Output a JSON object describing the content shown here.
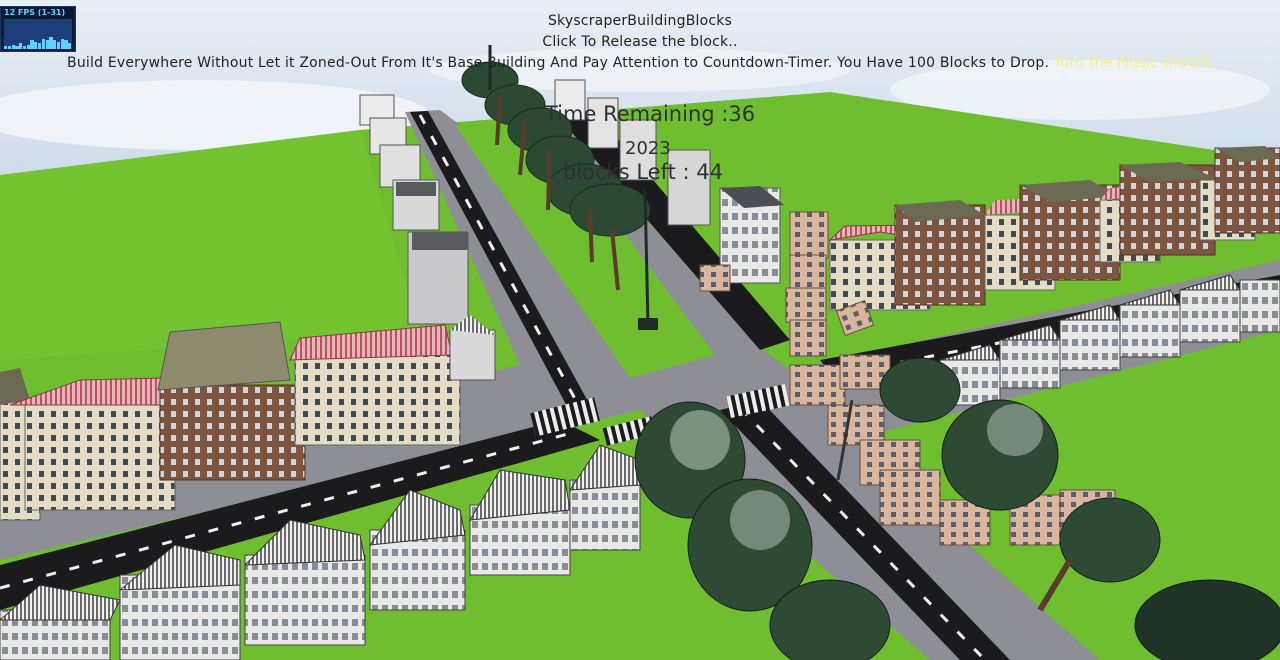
{
  "hud": {
    "fps_label": "12 FPS (1-31)",
    "title": "SkyscraperBuildingBlocks",
    "click_text": "Click To Release the block..",
    "instructions": "Build Everywhere Without Let it Zoned-Out From It's Base-Building And Pay Attention to Countdown-Timer. You Have 100 Blocks to Drop.",
    "music_link": "Turn the Music On/Off.",
    "time_remaining": "Time Remaining :36",
    "counter": "2023",
    "blocks_left": "blocks Left : 44"
  },
  "fps_graph": [
    0.1,
    0.1,
    0.15,
    0.1,
    0.2,
    0.1,
    0.15,
    0.3,
    0.25,
    0.2,
    0.35,
    0.3,
    0.4,
    0.3,
    0.25,
    0.35,
    0.3,
    0.2
  ],
  "colors": {
    "sky": "#cfdbe8",
    "grass": "#6fbe2f",
    "road": "#8e8f96",
    "asphalt": "#1b1b1d",
    "music_link": "#f4f07a"
  }
}
